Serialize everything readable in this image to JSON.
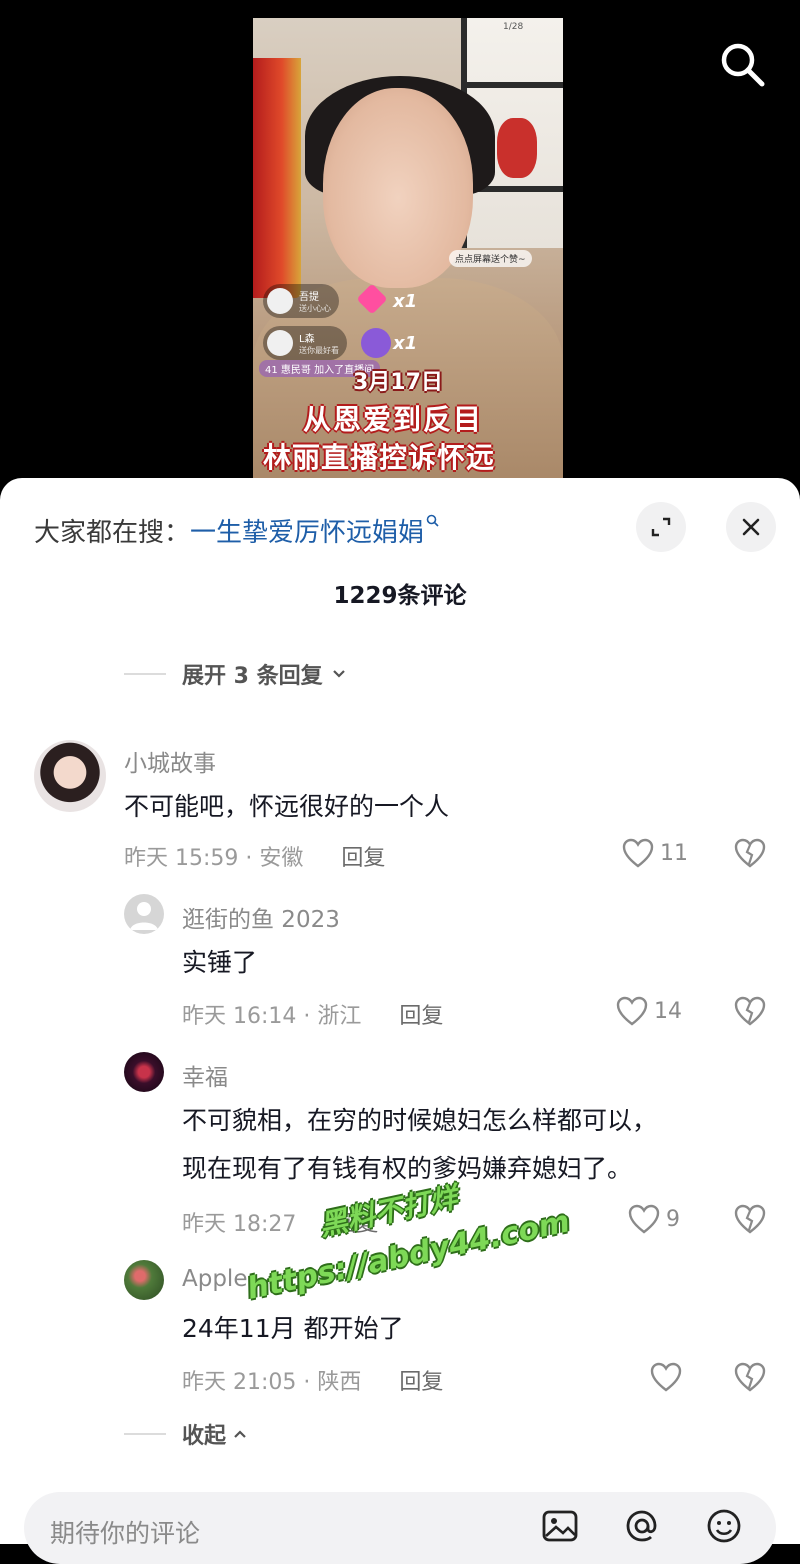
{
  "video": {
    "captions": [
      "3月17日",
      "从恩爱到反目",
      "林丽直播控诉怀远"
    ],
    "tap_hint": "点点屏幕送个赞~",
    "gifts": [
      {
        "user": "吾提",
        "sub": "送小心心",
        "count": "x1"
      },
      {
        "user": "L森",
        "sub": "送你最好看",
        "count": "x1"
      }
    ],
    "live_tag": "41 惠民哥 加入了直播间",
    "shelf_label": "1/28",
    "search_icon": "search-icon"
  },
  "sheet": {
    "header_prefix": "大家都在搜：",
    "header_query": "一生挚爱厉怀远娟娟",
    "comment_count": "1229条评论",
    "expand_label": "展开 3 条回复",
    "collapse_label": "收起"
  },
  "comments": [
    {
      "user": "小城故事",
      "text": "不可能吧，怀远很好的一个人",
      "time": "昨天 15:59 · 安徽",
      "reply": "回复",
      "likes": "11"
    },
    {
      "user": "逛街的鱼 2023",
      "text": "实锤了",
      "time": "昨天 16:14 · 浙江",
      "reply": "回复",
      "likes": "14"
    },
    {
      "user": "幸福",
      "text_lines": [
        "不可貌相，在穷的时候媳妇怎么样都可以，",
        "现在现有了有钱有权的爹妈嫌弃媳妇了。"
      ],
      "time": "昨天 18:27",
      "reply": "回复",
      "likes": "9"
    },
    {
      "user": "Apple",
      "text": "24年11月 都开始了",
      "time": "昨天 21:05 · 陕西",
      "reply": "回复",
      "likes": ""
    }
  ],
  "watermark": {
    "line1": "黑料不打烊",
    "line2": "https://abdy44.com"
  },
  "input": {
    "placeholder": "期待你的评论"
  },
  "colors": {
    "query_blue": "#1e5ea8",
    "watermark_green": "#7ed957"
  }
}
